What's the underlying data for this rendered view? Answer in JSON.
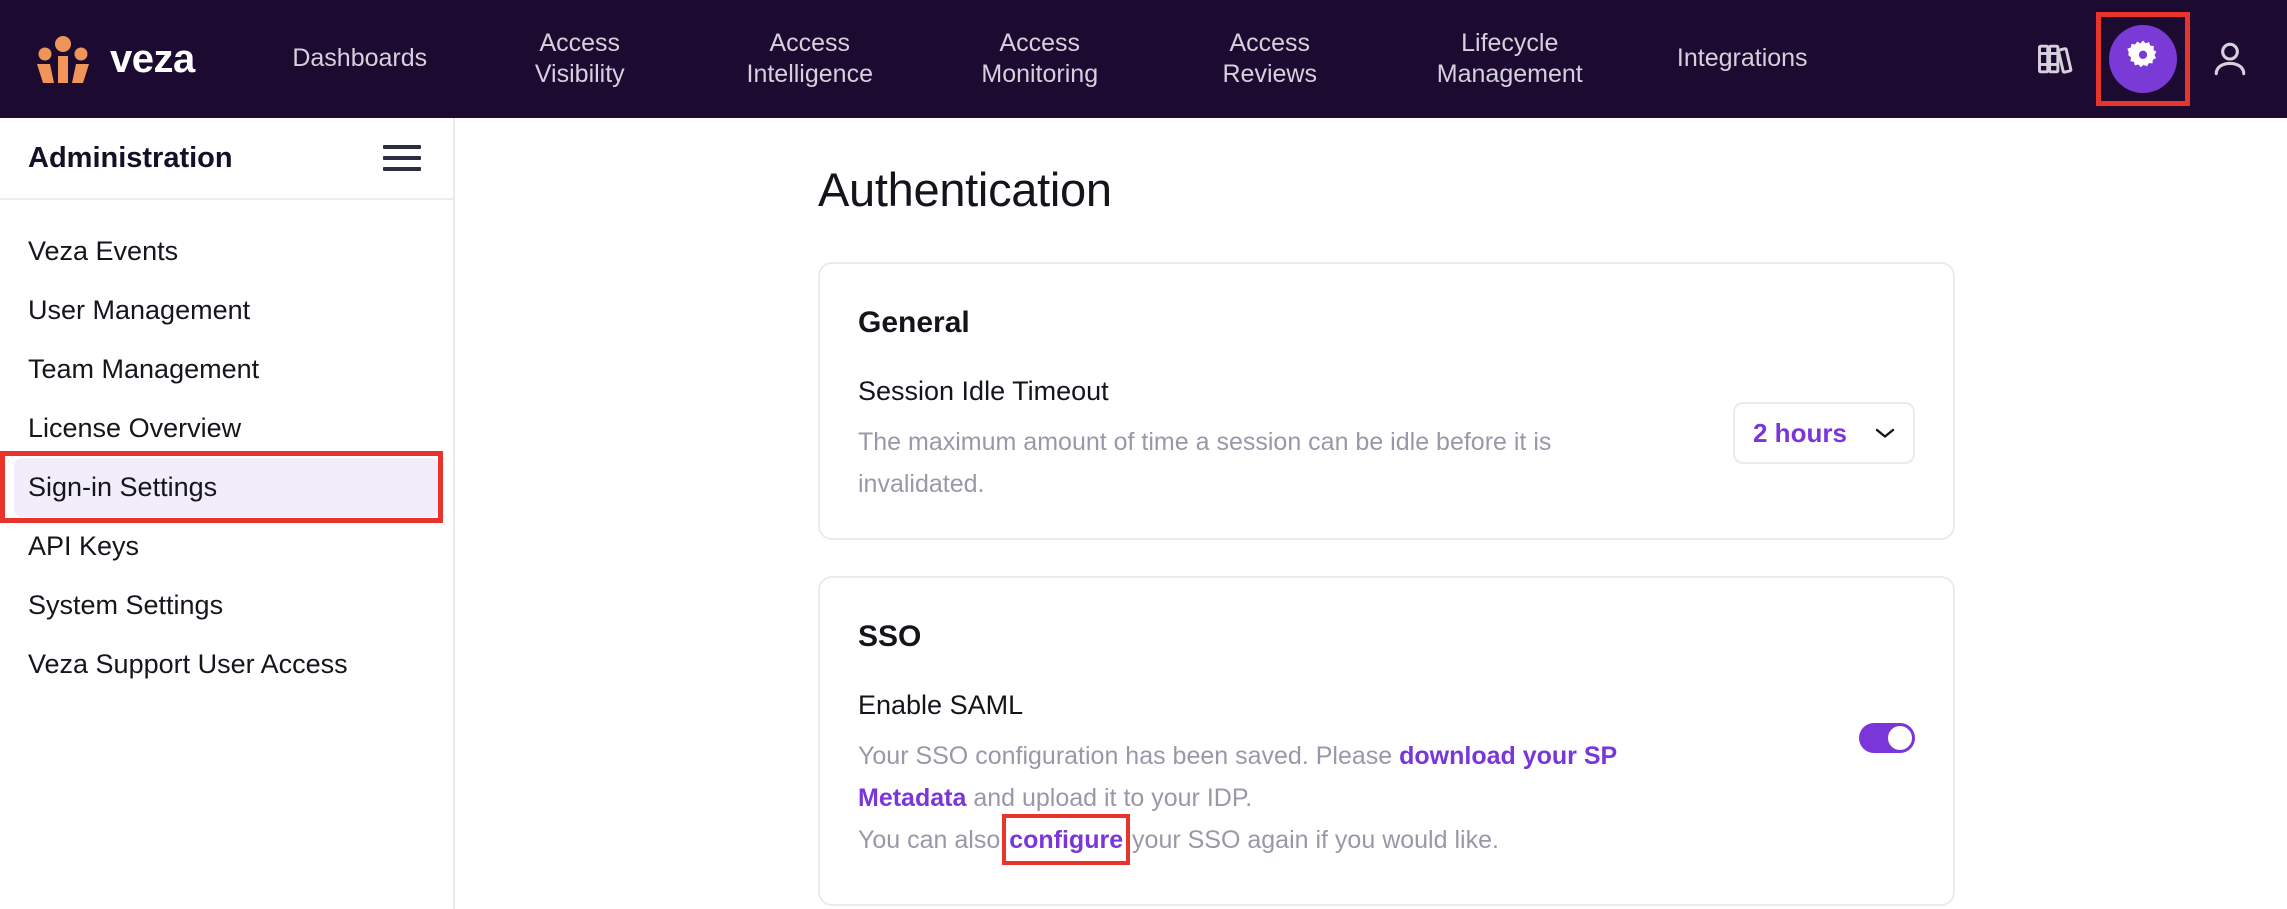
{
  "topnav": {
    "brand_name": "veza",
    "logo_icon": "veza-logo-icon",
    "items": [
      {
        "label": "Dashboards",
        "icon": ""
      },
      {
        "label": "Access\nVisibility",
        "icon": ""
      },
      {
        "label": "Access\nIntelligence",
        "icon": ""
      },
      {
        "label": "Access\nMonitoring",
        "icon": ""
      },
      {
        "label": "Access\nReviews",
        "icon": ""
      },
      {
        "label": "Lifecycle\nManagement",
        "icon": ""
      },
      {
        "label": "Integrations",
        "icon": ""
      }
    ],
    "library_icon": "library-books-icon",
    "settings_icon": "gear-icon",
    "profile_icon": "user-avatar-icon",
    "background_color": "#1c0a31",
    "accent_color": "#7a3ad6",
    "highlight_color": "#e8342a"
  },
  "sidebar": {
    "title": "Administration",
    "menu_icon": "hamburger-menu-icon",
    "items": [
      {
        "label": "Veza Events",
        "active": false
      },
      {
        "label": "User Management",
        "active": false
      },
      {
        "label": "Team Management",
        "active": false
      },
      {
        "label": "License Overview",
        "active": false
      },
      {
        "label": "Sign-in Settings",
        "active": true
      },
      {
        "label": "API Keys",
        "active": false
      },
      {
        "label": "System Settings",
        "active": false
      },
      {
        "label": "Veza Support User Access",
        "active": false
      }
    ],
    "active_bg_color": "#f1edfa"
  },
  "main": {
    "page_title": "Authentication",
    "general_card": {
      "title": "General",
      "setting_label": "Session Idle Timeout",
      "setting_description": "The maximum amount of time a session can be idle before it is invalidated.",
      "select_value": "2 hours",
      "select_icon": "chevron-down-icon"
    },
    "sso_card": {
      "title": "SSO",
      "setting_label": "Enable SAML",
      "desc_line1_part1": "Your SSO configuration has been saved. Please ",
      "desc_link_download": "download your SP Metadata",
      "desc_line1_part2": " and upload it to your IDP.",
      "desc_line2_part1": "You can also ",
      "desc_link_configure": "configure",
      "desc_line2_part2": " your SSO again if you would like.",
      "toggle_state": "on",
      "toggle_icon": "toggle-switch-on-icon"
    }
  }
}
